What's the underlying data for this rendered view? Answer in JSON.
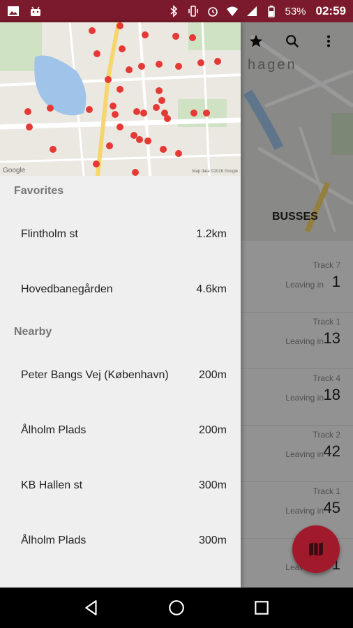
{
  "status_bar": {
    "battery": "53%",
    "time": "02:59"
  },
  "background": {
    "city_partial": "hagen",
    "map_label": "BUSSES",
    "departures": [
      {
        "track": "Track 7",
        "leaving": "Leaving in",
        "minutes": "1"
      },
      {
        "track": "Track 1",
        "leaving": "Leaving in",
        "minutes": "13"
      },
      {
        "track": "Track 4",
        "leaving": "Leaving in",
        "minutes": "18"
      },
      {
        "track": "Track 2",
        "leaving": "Leaving in",
        "minutes": "42"
      },
      {
        "track": "Track 1",
        "leaving": "Leaving in",
        "minutes": "45"
      },
      {
        "track": "",
        "leaving": "Leaving in",
        "minutes": "1"
      }
    ]
  },
  "drawer": {
    "map": {
      "google": "Google",
      "copyright": "Map data ©2016 Google"
    },
    "favorites_header": "Favorites",
    "favorites": [
      {
        "name": "Flintholm st",
        "distance": "1.2km"
      },
      {
        "name": "Hovedbanegården",
        "distance": "4.6km"
      }
    ],
    "nearby_header": "Nearby",
    "nearby": [
      {
        "name": "Peter Bangs Vej (København)",
        "distance": "200m"
      },
      {
        "name": "Ålholm Plads",
        "distance": "200m"
      },
      {
        "name": "KB Hallen st",
        "distance": "300m"
      },
      {
        "name": "Ålholm Plads",
        "distance": "300m"
      }
    ]
  },
  "colors": {
    "accent": "#7b1a2c",
    "fab": "#a11a2b",
    "pin": "#e53935"
  }
}
